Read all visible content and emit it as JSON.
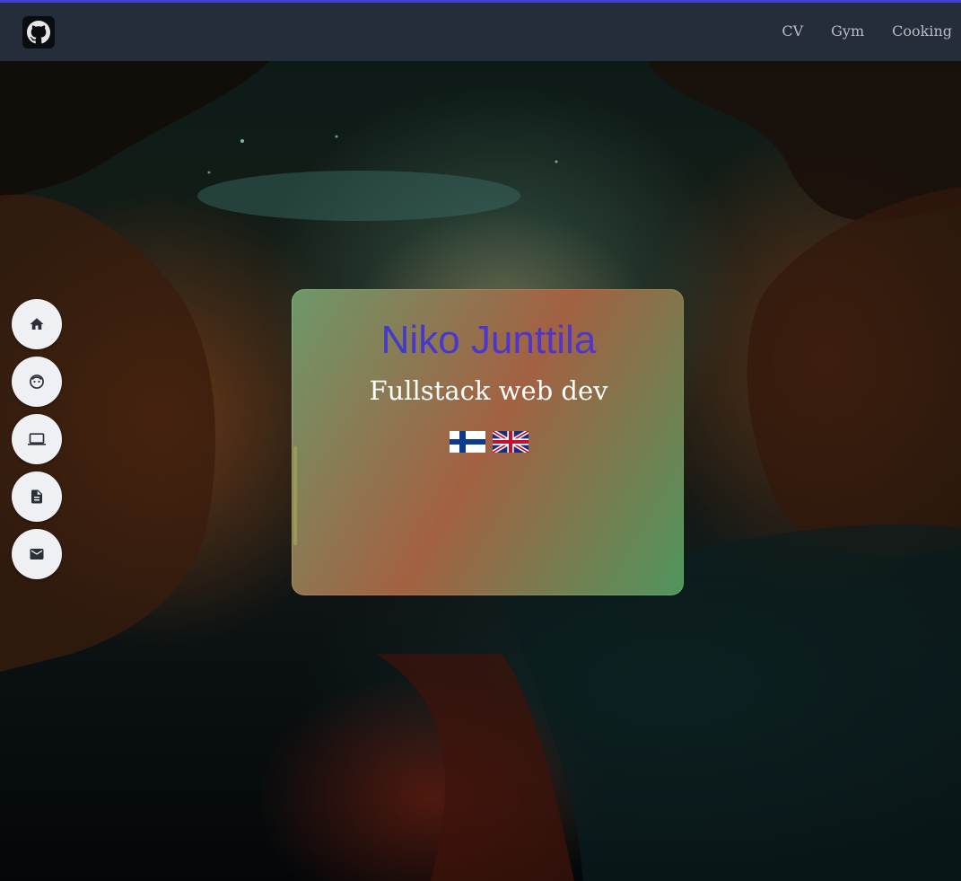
{
  "navbar": {
    "logo_icon": "github-icon",
    "links": [
      {
        "label": "CV"
      },
      {
        "label": "Gym"
      },
      {
        "label": "Cooking"
      }
    ]
  },
  "sidenav": {
    "items": [
      {
        "icon": "home-icon"
      },
      {
        "icon": "face-icon"
      },
      {
        "icon": "laptop-icon"
      },
      {
        "icon": "document-icon"
      },
      {
        "icon": "mail-icon"
      }
    ]
  },
  "hero": {
    "name": "Niko Junttila",
    "subtitle": "Fullstack web dev",
    "languages": [
      {
        "icon": "finnish-flag-icon"
      },
      {
        "icon": "uk-flag-icon"
      }
    ]
  },
  "colors": {
    "accent_line": "#3f3fd8",
    "navbar_bg": "#262d3a",
    "name_gradient_start": "#3a3ad0",
    "name_gradient_end": "#5a34c8"
  }
}
